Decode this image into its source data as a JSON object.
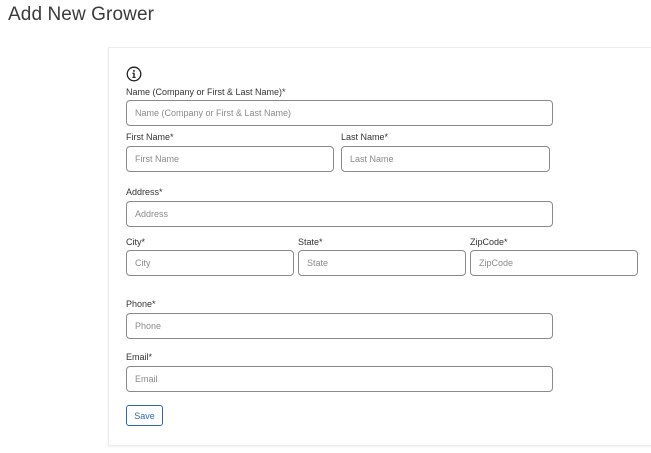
{
  "page": {
    "title": "Add New Grower"
  },
  "form": {
    "info_icon": "info-circle-icon",
    "name": {
      "label": "Name (Company or First & Last Name)*",
      "placeholder": "Name (Company or First & Last Name)",
      "value": ""
    },
    "first_name": {
      "label": "First Name*",
      "placeholder": "First Name",
      "value": ""
    },
    "last_name": {
      "label": "Last Name*",
      "placeholder": "Last Name",
      "value": ""
    },
    "address": {
      "label": "Address*",
      "placeholder": "Address",
      "value": ""
    },
    "city": {
      "label": "City*",
      "placeholder": "City",
      "value": ""
    },
    "state": {
      "label": "State*",
      "placeholder": "State",
      "value": ""
    },
    "zipcode": {
      "label": "ZipCode*",
      "placeholder": "ZipCode",
      "value": ""
    },
    "phone": {
      "label": "Phone*",
      "placeholder": "Phone",
      "value": ""
    },
    "email": {
      "label": "Email*",
      "placeholder": "Email",
      "value": ""
    },
    "save_label": "Save"
  },
  "colors": {
    "accent": "#2f6aa8",
    "field_border": "#8a8a8a",
    "placeholder": "#8a8a8a"
  }
}
